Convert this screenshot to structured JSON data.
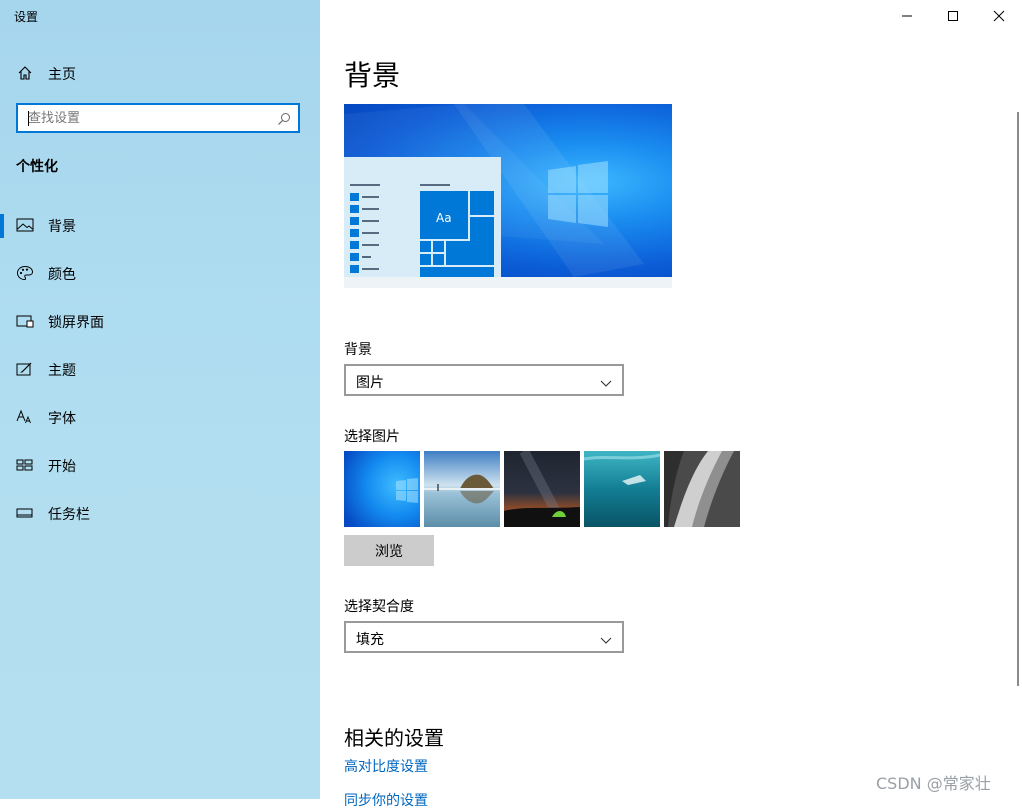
{
  "window": {
    "title": "设置",
    "minimize_icon": "minimize-icon",
    "maximize_icon": "maximize-icon",
    "close_icon": "close-icon"
  },
  "sidebar": {
    "home_label": "主页",
    "search": {
      "placeholder": "查找设置",
      "value": ""
    },
    "section_title": "个性化",
    "items": [
      {
        "label": "背景",
        "icon": "picture-icon",
        "active": true
      },
      {
        "label": "颜色",
        "icon": "palette-icon",
        "active": false
      },
      {
        "label": "锁屏界面",
        "icon": "lock-screen-icon",
        "active": false
      },
      {
        "label": "主题",
        "icon": "theme-icon",
        "active": false
      },
      {
        "label": "字体",
        "icon": "font-icon",
        "active": false
      },
      {
        "label": "开始",
        "icon": "start-icon",
        "active": false
      },
      {
        "label": "任务栏",
        "icon": "taskbar-icon",
        "active": false
      }
    ]
  },
  "main": {
    "title": "背景",
    "preview": {
      "tile_text": "Aa"
    },
    "background": {
      "label": "背景",
      "selected": "图片"
    },
    "choose_picture": {
      "label": "选择图片",
      "browse_label": "浏览"
    },
    "fit": {
      "label": "选择契合度",
      "selected": "填充"
    },
    "related": {
      "title": "相关的设置",
      "links": [
        "高对比度设置",
        "同步你的设置"
      ]
    }
  },
  "watermark": "CSDN @常家壮",
  "colors": {
    "accent": "#0078d7",
    "link": "#0067c0",
    "sidebar": "#b1def0"
  }
}
